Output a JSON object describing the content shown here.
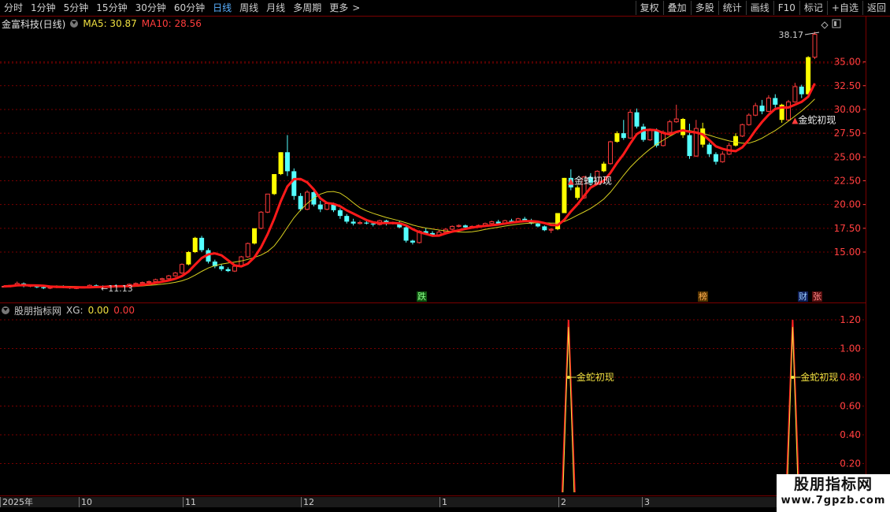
{
  "toolbar": {
    "periods": [
      "分时",
      "1分钟",
      "5分钟",
      "15分钟",
      "30分钟",
      "60分钟",
      "日线",
      "周线",
      "月线",
      "多周期",
      "更多"
    ],
    "active_period": "日线",
    "more_arrow": ">",
    "right_buttons": [
      "复权",
      "叠加",
      "多股",
      "统计",
      "画线",
      "F10",
      "标记",
      "+自选",
      "返回"
    ]
  },
  "main_panel": {
    "title": "金富科技(日线)",
    "ma5_label": "MA5: 30.87",
    "ma10_label": "MA10: 28.56",
    "price_axis": [
      "35.00",
      "32.50",
      "30.00",
      "27.50",
      "25.00",
      "22.50",
      "20.00",
      "17.50",
      "15.00"
    ],
    "high_marker": "38.17",
    "low_marker": "11.13",
    "signal_text": "金蛇初现",
    "event_tags": [
      {
        "text": "跌",
        "kind": "green"
      },
      {
        "text": "榜",
        "kind": "orange"
      },
      {
        "text": "财",
        "kind": "blue"
      },
      {
        "text": "张",
        "kind": "red"
      }
    ]
  },
  "sub_panel": {
    "title": "股朋指标网",
    "xg_label": "XG:",
    "xg_value": "0.00",
    "xg_value2": "0.00",
    "axis": [
      "1.20",
      "1.00",
      "0.80",
      "0.60",
      "0.40",
      "0.20"
    ],
    "signal_text": "金蛇初现"
  },
  "date_axis": [
    "2025年",
    "10",
    "11",
    "12",
    "1",
    "2",
    "3"
  ],
  "watermark": {
    "line1": "股朋指标网",
    "line2": "www.7gpzb.com"
  },
  "colors": {
    "up": "#ff3c3c",
    "down": "#54ffff",
    "ma5": "#f0e040",
    "ma10": "#ff1a1a",
    "limit_up": "#ffff00",
    "grid": "#7a0000"
  },
  "chart_data": {
    "type": "candlestick",
    "ylim": [
      10,
      40
    ],
    "candles": [
      [
        11.4,
        11.5,
        11.3,
        11.4
      ],
      [
        11.4,
        11.5,
        11.3,
        11.5
      ],
      [
        11.5,
        11.9,
        11.4,
        11.7
      ],
      [
        11.7,
        11.8,
        11.3,
        11.4
      ],
      [
        11.4,
        11.6,
        11.3,
        11.5
      ],
      [
        11.5,
        11.6,
        11.2,
        11.3
      ],
      [
        11.3,
        11.4,
        11.1,
        11.2
      ],
      [
        11.2,
        11.4,
        11.1,
        11.3
      ],
      [
        11.3,
        11.5,
        11.2,
        11.4
      ],
      [
        11.4,
        11.5,
        11.2,
        11.3
      ],
      [
        11.3,
        11.4,
        11.13,
        11.2
      ],
      [
        11.2,
        11.3,
        11.1,
        11.25
      ],
      [
        11.25,
        11.4,
        11.2,
        11.3
      ],
      [
        11.3,
        11.6,
        11.2,
        11.5
      ],
      [
        11.5,
        11.6,
        11.3,
        11.4
      ],
      [
        11.4,
        11.5,
        11.2,
        11.3
      ],
      [
        11.3,
        11.5,
        11.2,
        11.45
      ],
      [
        11.45,
        11.6,
        11.3,
        11.4
      ],
      [
        11.4,
        11.5,
        11.3,
        11.45
      ],
      [
        11.45,
        11.7,
        11.4,
        11.6
      ],
      [
        11.6,
        11.8,
        11.5,
        11.7
      ],
      [
        11.7,
        11.9,
        11.6,
        11.8
      ],
      [
        11.8,
        12.0,
        11.7,
        11.9
      ],
      [
        11.9,
        12.2,
        11.8,
        12.1
      ],
      [
        12.1,
        12.3,
        12.0,
        12.2
      ],
      [
        12.2,
        12.6,
        12.1,
        12.5
      ],
      [
        12.5,
        12.9,
        12.4,
        12.8
      ],
      [
        12.8,
        13.8,
        12.7,
        13.7
      ],
      [
        13.7,
        15.1,
        13.6,
        15.0
      ],
      [
        15.0,
        16.6,
        14.9,
        16.5
      ],
      [
        16.5,
        16.7,
        15.0,
        15.2
      ],
      [
        15.2,
        15.4,
        13.8,
        14.0
      ],
      [
        14.0,
        14.2,
        13.3,
        13.5
      ],
      [
        13.5,
        13.7,
        13.0,
        13.2
      ],
      [
        13.2,
        13.4,
        12.9,
        13.0
      ],
      [
        13.0,
        13.6,
        12.9,
        13.5
      ],
      [
        13.5,
        14.6,
        13.4,
        14.5
      ],
      [
        14.5,
        16.0,
        14.4,
        15.9
      ],
      [
        15.9,
        17.5,
        15.8,
        17.5
      ],
      [
        17.5,
        19.3,
        17.4,
        19.2
      ],
      [
        19.2,
        21.1,
        19.1,
        21.1
      ],
      [
        21.1,
        23.2,
        21.0,
        23.2
      ],
      [
        23.2,
        25.5,
        23.1,
        25.5
      ],
      [
        25.5,
        27.3,
        23.0,
        23.5
      ],
      [
        23.5,
        23.8,
        20.5,
        20.9
      ],
      [
        20.9,
        21.2,
        19.3,
        19.5
      ],
      [
        19.5,
        21.5,
        19.4,
        21.3
      ],
      [
        21.3,
        21.5,
        19.8,
        20.0
      ],
      [
        20.0,
        20.4,
        19.2,
        19.5
      ],
      [
        19.5,
        20.3,
        19.4,
        20.1
      ],
      [
        20.1,
        20.2,
        19.2,
        19.4
      ],
      [
        19.4,
        19.6,
        18.5,
        18.8
      ],
      [
        18.8,
        19.0,
        18.0,
        18.2
      ],
      [
        18.2,
        18.5,
        17.8,
        18.0
      ],
      [
        18.0,
        18.3,
        17.9,
        18.1
      ],
      [
        18.1,
        18.4,
        17.9,
        18.0
      ],
      [
        18.0,
        18.2,
        17.7,
        17.9
      ],
      [
        17.9,
        18.4,
        17.8,
        18.3
      ],
      [
        18.3,
        18.4,
        17.8,
        18.0
      ],
      [
        18.0,
        18.2,
        17.9,
        18.1
      ],
      [
        18.1,
        18.3,
        17.5,
        17.6
      ],
      [
        17.6,
        17.7,
        16.0,
        16.2
      ],
      [
        16.2,
        16.3,
        15.8,
        16.0
      ],
      [
        16.0,
        17.3,
        15.9,
        17.2
      ],
      [
        17.2,
        17.5,
        16.8,
        17.0
      ],
      [
        17.0,
        17.2,
        16.6,
        16.8
      ],
      [
        16.8,
        17.3,
        16.7,
        17.1
      ],
      [
        17.1,
        17.5,
        17.0,
        17.4
      ],
      [
        17.4,
        17.8,
        17.3,
        17.7
      ],
      [
        17.7,
        17.9,
        17.6,
        17.8
      ],
      [
        17.8,
        17.9,
        17.5,
        17.6
      ],
      [
        17.6,
        17.8,
        17.5,
        17.7
      ],
      [
        17.7,
        17.9,
        17.6,
        17.8
      ],
      [
        17.8,
        18.1,
        17.7,
        18.0
      ],
      [
        18.0,
        18.3,
        17.9,
        18.2
      ],
      [
        18.2,
        18.4,
        17.9,
        18.0
      ],
      [
        18.0,
        18.4,
        17.9,
        18.3
      ],
      [
        18.3,
        18.5,
        18.1,
        18.2
      ],
      [
        18.2,
        18.6,
        18.1,
        18.5
      ],
      [
        18.5,
        18.7,
        18.2,
        18.3
      ],
      [
        18.3,
        18.5,
        17.9,
        18.0
      ],
      [
        18.0,
        18.2,
        17.6,
        17.7
      ],
      [
        17.7,
        17.8,
        17.2,
        17.3
      ],
      [
        17.3,
        17.5,
        17.0,
        17.4
      ],
      [
        17.4,
        19.1,
        17.3,
        19.1
      ],
      [
        19.1,
        22.8,
        21.0,
        22.8
      ],
      [
        22.8,
        23.7,
        21.5,
        21.8
      ],
      [
        21.8,
        22.0,
        20.5,
        20.7
      ],
      [
        20.7,
        23.0,
        20.6,
        22.9
      ],
      [
        22.9,
        23.3,
        22.0,
        22.3
      ],
      [
        22.3,
        23.6,
        22.2,
        23.5
      ],
      [
        23.5,
        24.5,
        23.4,
        24.3
      ],
      [
        24.3,
        26.7,
        24.2,
        26.6
      ],
      [
        26.6,
        27.7,
        26.5,
        27.5
      ],
      [
        27.5,
        28.9,
        26.8,
        27.0
      ],
      [
        27.0,
        30.0,
        26.9,
        29.7
      ],
      [
        29.7,
        30.1,
        28.0,
        28.2
      ],
      [
        28.2,
        28.5,
        26.6,
        26.8
      ],
      [
        26.8,
        28.0,
        26.7,
        27.8
      ],
      [
        27.8,
        28.0,
        26.0,
        26.2
      ],
      [
        26.2,
        27.8,
        26.1,
        27.6
      ],
      [
        27.6,
        28.9,
        27.5,
        28.7
      ],
      [
        28.7,
        30.5,
        28.6,
        29.0
      ],
      [
        29.0,
        29.1,
        27.0,
        27.3
      ],
      [
        27.3,
        28.5,
        24.8,
        25.1
      ],
      [
        25.1,
        28.9,
        25.0,
        28.0
      ],
      [
        28.0,
        28.6,
        26.0,
        26.3
      ],
      [
        26.3,
        26.5,
        25.0,
        25.3
      ],
      [
        25.3,
        25.5,
        24.2,
        24.5
      ],
      [
        24.5,
        25.6,
        24.4,
        25.3
      ],
      [
        25.3,
        26.5,
        25.2,
        26.2
      ],
      [
        26.2,
        27.5,
        26.1,
        27.2
      ],
      [
        27.2,
        28.5,
        27.1,
        28.4
      ],
      [
        28.4,
        29.6,
        28.3,
        29.4
      ],
      [
        29.4,
        30.7,
        29.3,
        30.4
      ],
      [
        30.4,
        31.0,
        29.5,
        29.8
      ],
      [
        29.8,
        31.5,
        29.7,
        31.2
      ],
      [
        31.2,
        31.6,
        30.2,
        30.5
      ],
      [
        30.5,
        30.6,
        28.6,
        28.9
      ],
      [
        28.9,
        31.0,
        28.8,
        30.8
      ],
      [
        30.8,
        32.8,
        30.7,
        32.4
      ],
      [
        32.4,
        32.6,
        31.2,
        31.6
      ],
      [
        31.6,
        35.6,
        31.5,
        35.5
      ],
      [
        35.5,
        38.17,
        35.3,
        37.9
      ]
    ],
    "limit_up_days": [
      28,
      29,
      38,
      41,
      42,
      84,
      85,
      87,
      91,
      93,
      103,
      106,
      111,
      118,
      122
    ]
  }
}
